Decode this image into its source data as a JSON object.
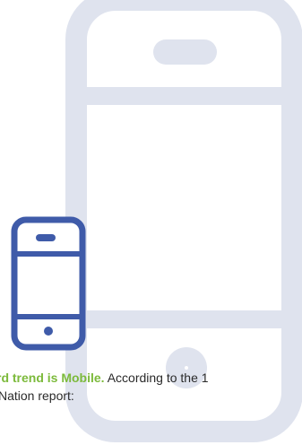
{
  "illustration": {
    "large_phone_icon": "smartphone-outline-icon",
    "small_phone_icon": "smartphone-outline-icon",
    "colors": {
      "large_phone": "#dfe3ee",
      "small_phone": "#3f5ba9",
      "highlight": "#7cba3b",
      "text": "#2a2a2a"
    }
  },
  "caption": {
    "highlight": "rd trend is Mobile.",
    "rest_line1": " According to the 1",
    "line2": "Nation report:"
  }
}
